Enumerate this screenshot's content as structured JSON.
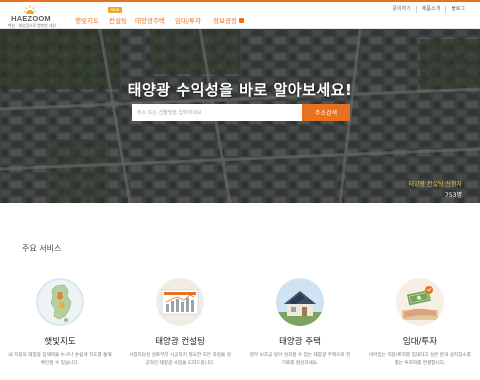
{
  "brand": {
    "name": "HAEZOOM",
    "tagline": "햇살 · 태양광으로 행복한 세상"
  },
  "colors": {
    "accent": "#e8711f",
    "badge": "#f2a623",
    "stat_label": "#f2c84b"
  },
  "utility_links": [
    "문의하기",
    "제품소개",
    "블로그"
  ],
  "nav": {
    "items": [
      {
        "label": "햇빛지도",
        "icon": null
      },
      {
        "label": "컨설팅",
        "icon": null
      },
      {
        "label": "태양광주택",
        "icon": null
      },
      {
        "label": "임대/투자",
        "icon": null
      },
      {
        "label": "정보광장",
        "icon": "external-link-icon"
      }
    ],
    "badge": "NEW"
  },
  "hero": {
    "title": "태양광 수익성을 바로 알아보세요!",
    "search_placeholder": "주소 또는 건물명을 입력하세요",
    "search_button": "주소검색",
    "stat_label": "태양광 컨설팅 신청자",
    "stat_value": "753명"
  },
  "section": {
    "title": "주요 서비스"
  },
  "services": [
    {
      "title": "햇빛지도",
      "desc": "내 지붕의 태양광 잠재력을 누구나 손쉽게 지도를 통해 확인할 수 있습니다.",
      "icon": "korea-map-icon"
    },
    {
      "title": "태양광 컨설팅",
      "desc": "사업타당성 검토부터 시공까지 필요한 모든 과정을 성공적인 태양광 사업을 도와드립니다.",
      "icon": "consulting-chart-icon"
    },
    {
      "title": "태양광 주택",
      "desc": "정부 보조금 받아 설치할 수 있는 태양광 주택으로 전기료를 절감하세요.",
      "icon": "solar-house-icon"
    },
    {
      "title": "임대/투자",
      "desc": "비어있는 지붕/토지를 임대하고 싶은 분과 설치장소를 찾는 투자자를 연결합니다.",
      "icon": "money-hand-icon"
    }
  ]
}
